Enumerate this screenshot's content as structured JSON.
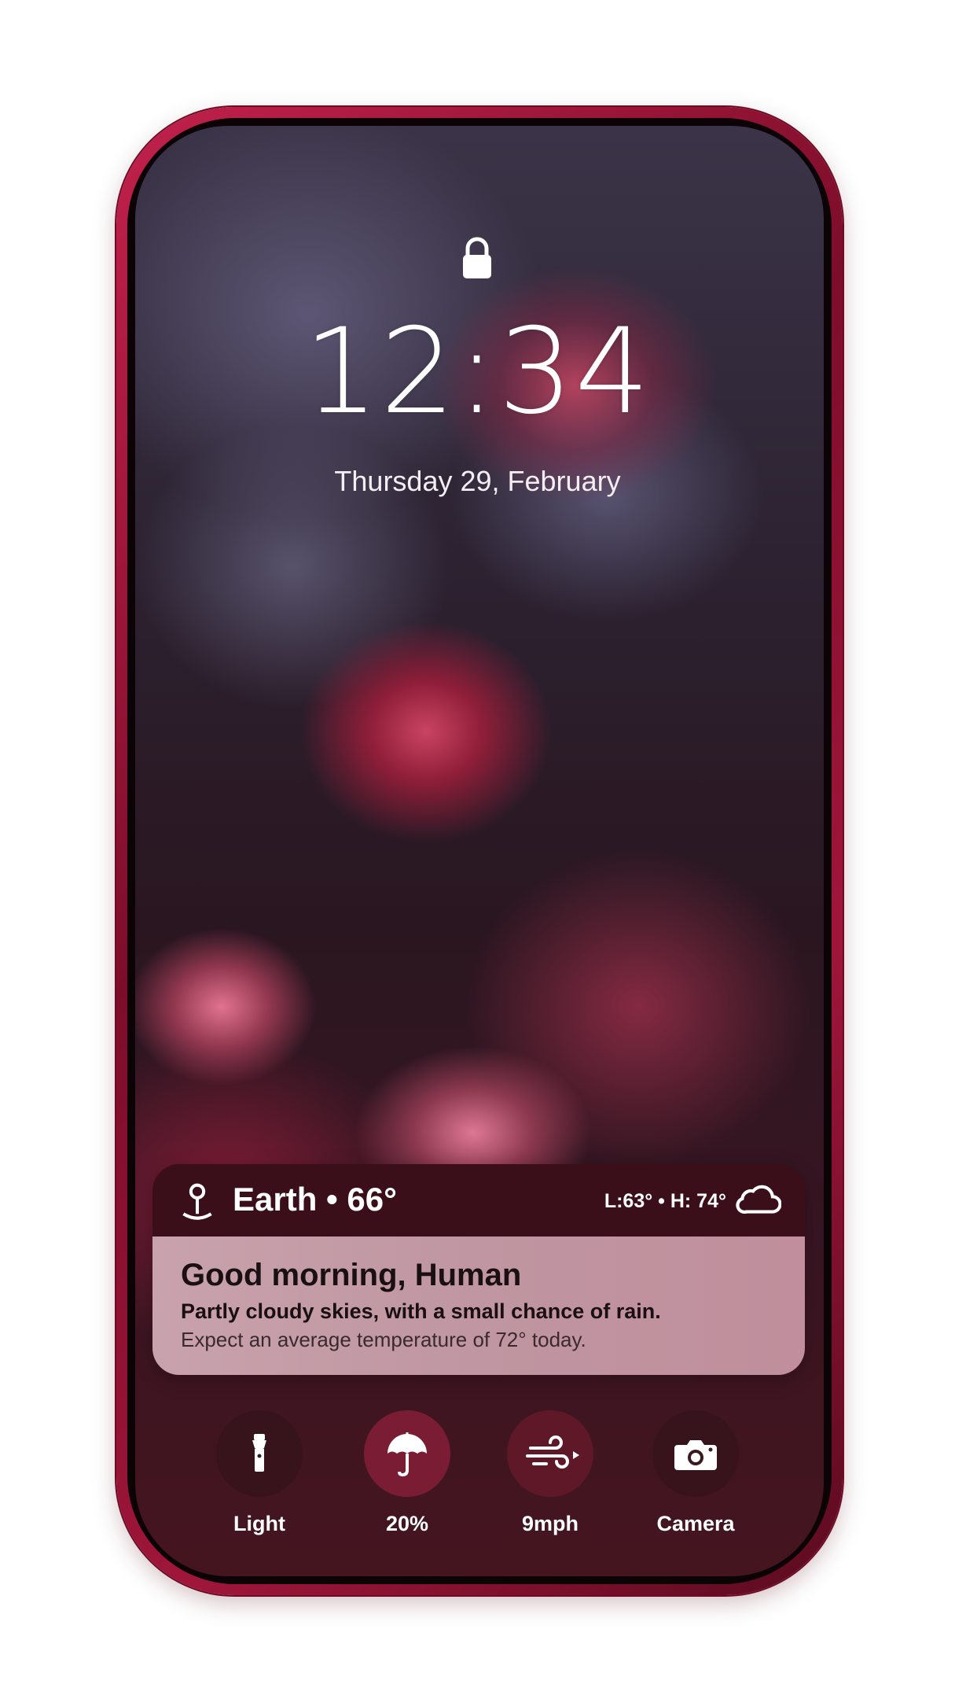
{
  "lockscreen": {
    "time": "12:34",
    "date": "Thursday 29, February"
  },
  "weather_widget": {
    "location": "Earth • 66°",
    "hilo": "L:63° • H: 74°",
    "greeting": "Good morning, Human",
    "forecast": "Partly cloudy skies, with a small chance of rain.",
    "expectation": "Expect an average temperature of 72° today.",
    "icons": {
      "location": "location-pin-icon",
      "condition": "cloud-icon"
    }
  },
  "quick_actions": [
    {
      "label": "Light",
      "icon": "flashlight-icon"
    },
    {
      "label": "20%",
      "icon": "umbrella-icon"
    },
    {
      "label": "9mph",
      "icon": "wind-icon"
    },
    {
      "label": "Camera",
      "icon": "camera-icon"
    }
  ],
  "colors": {
    "frame": "#a0163b",
    "widget_header": "#3a0f1a",
    "widget_body": "#c8a2ac",
    "rain_button": "#7a1d34",
    "wind_button": "#5e1828"
  }
}
